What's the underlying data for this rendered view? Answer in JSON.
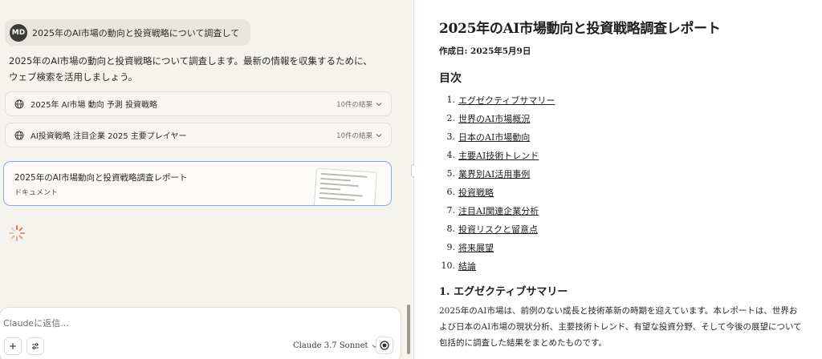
{
  "chat": {
    "user_initials": "MD",
    "user_message": "2025年のAI市場の動向と投資戦略について調査して",
    "assistant_message": "2025年のAI市場の動向と投資戦略について調査します。最新の情報を収集するために、ウェブ検索を活用しましょう。",
    "searches": [
      {
        "query": "2025年 AI市場 動向 予測 投資戦略",
        "results": "10件の結果"
      },
      {
        "query": "AI投資戦略 注目企業 2025 主要プレイヤー",
        "results": "10件の結果"
      }
    ],
    "artifact": {
      "title": "2025年のAI市場動向と投資戦略調査レポート",
      "type": "ドキュメント"
    },
    "input_placeholder": "Claudeに返信...",
    "model_name": "Claude 3.7 Sonnet"
  },
  "document": {
    "title": "2025年のAI市場動向と投資戦略調査レポート",
    "date": "作成日: 2025年5月9日",
    "toc_heading": "目次",
    "toc": [
      {
        "num": "1.",
        "label": "エグゼクティブサマリー"
      },
      {
        "num": "2.",
        "label": "世界のAI市場概況"
      },
      {
        "num": "3.",
        "label": "日本のAI市場動向"
      },
      {
        "num": "4.",
        "label": "主要AI技術トレンド"
      },
      {
        "num": "5.",
        "label": "業界別AI活用事例"
      },
      {
        "num": "6.",
        "label": "投資戦略"
      },
      {
        "num": "7.",
        "label": "注目AI関連企業分析"
      },
      {
        "num": "8.",
        "label": "投資リスクと留意点"
      },
      {
        "num": "9.",
        "label": "将来展望"
      },
      {
        "num": "10.",
        "label": "結論"
      }
    ],
    "section1_heading": "1. エグゼクティブサマリー",
    "section1_text": "2025年のAI市場は、前例のない成長と技術革新の時期を迎えています。本レポートは、世界および日本のAI市場の現状分析、主要技術トレンド、有望な投資分野、そして今後の展望について包括的に調査した結果をまとめたものです。"
  }
}
